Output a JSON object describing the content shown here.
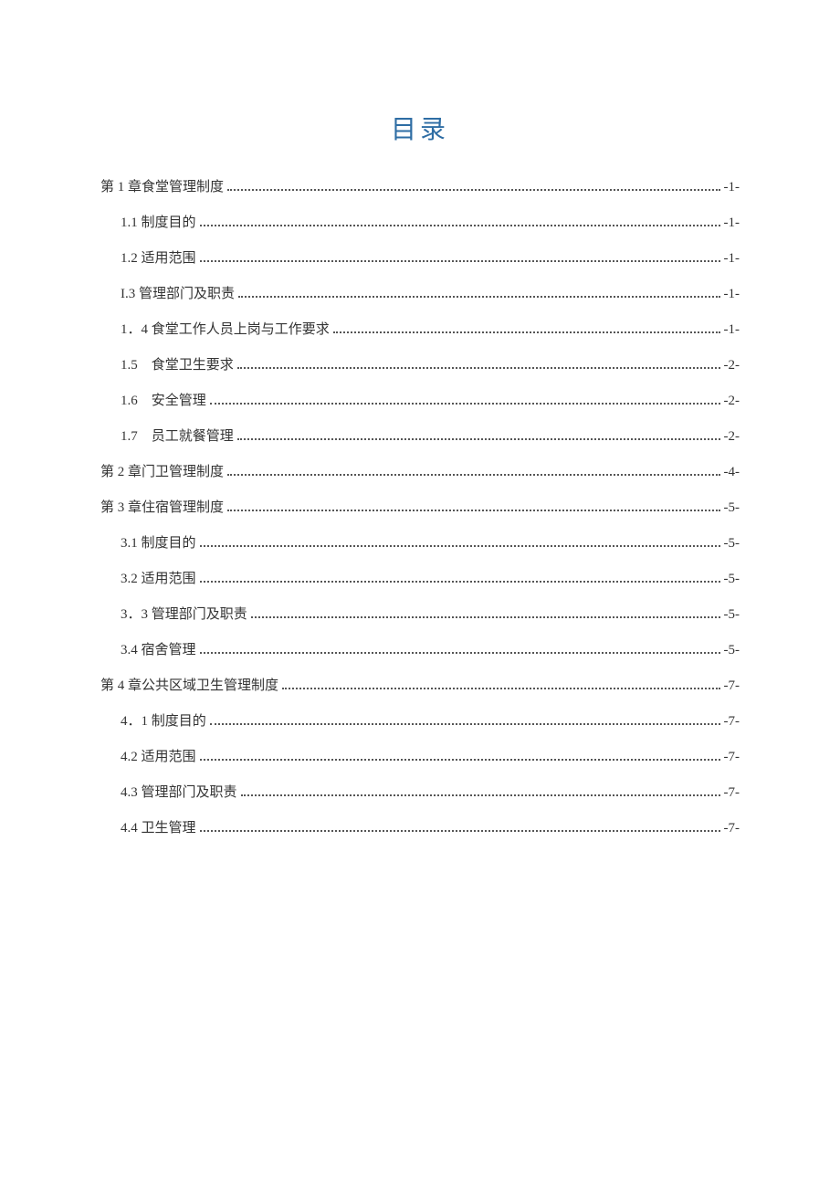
{
  "title": "目录",
  "toc": [
    {
      "indent": 0,
      "label": "第 1 章食堂管理制度",
      "page": "-1-"
    },
    {
      "indent": 1,
      "label": "1.1 制度目的",
      "page": "-1-"
    },
    {
      "indent": 1,
      "label": "1.2 适用范围",
      "page": "-1-"
    },
    {
      "indent": 1,
      "label": "I.3 管理部门及职责",
      "page": "-1-"
    },
    {
      "indent": 1,
      "label": "1．4 食堂工作人员上岗与工作要求",
      "page": "-1-"
    },
    {
      "indent": 2,
      "label": "1.5　食堂卫生要求",
      "page": "-2-"
    },
    {
      "indent": 2,
      "label": "1.6　安全管理",
      "page": "-2-"
    },
    {
      "indent": 2,
      "label": "1.7　员工就餐管理",
      "page": "-2-"
    },
    {
      "indent": 0,
      "label": "第 2 章门卫管理制度",
      "page": "-4-"
    },
    {
      "indent": 0,
      "label": "第 3 章住宿管理制度",
      "page": "-5-"
    },
    {
      "indent": 1,
      "label": "3.1 制度目的",
      "page": "-5-"
    },
    {
      "indent": 1,
      "label": "3.2 适用范围",
      "page": "-5-"
    },
    {
      "indent": 1,
      "label": "3．3 管理部门及职责",
      "page": "-5-"
    },
    {
      "indent": 1,
      "label": "3.4 宿舍管理",
      "page": "-5-"
    },
    {
      "indent": 0,
      "label": "第 4 章公共区域卫生管理制度",
      "page": "-7-"
    },
    {
      "indent": 1,
      "label": "4．1 制度目的",
      "page": "-7-"
    },
    {
      "indent": 1,
      "label": "4.2 适用范围",
      "page": "-7-"
    },
    {
      "indent": 1,
      "label": "4.3 管理部门及职责",
      "page": "-7-"
    },
    {
      "indent": 1,
      "label": "4.4 卫生管理",
      "page": "-7-"
    }
  ]
}
